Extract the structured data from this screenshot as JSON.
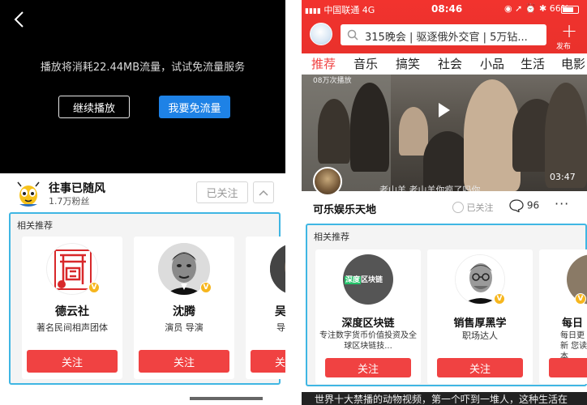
{
  "left": {
    "video": {
      "back_icon": "chevron-left-icon",
      "flow_notice": "播放将消耗22.44MB流量，试试免流量服务",
      "continue_label": "继续播放",
      "free_flow_label": "我要免流量"
    },
    "author": {
      "name": "往事已随风",
      "fans": "1.7万粉丝",
      "followed_label": "已关注",
      "collapse_icon": "chevron-up-icon"
    },
    "recommend": {
      "title": "相关推荐",
      "cards": [
        {
          "name": "德云社",
          "desc": "著名民间相声团体",
          "follow_label": "关注",
          "verified": "V"
        },
        {
          "name": "沈腾",
          "desc": "演员 导演",
          "follow_label": "关注",
          "verified": "V"
        },
        {
          "name": "吴",
          "desc": "导",
          "follow_label": "关",
          "verified": "V"
        }
      ]
    }
  },
  "right": {
    "status_bar": {
      "carrier": "中国联通 4G",
      "time": "08:46",
      "battery": "66%"
    },
    "header": {
      "search_text": "315晚会 | 驱逐俄外交官 | 5万钻...",
      "publish_label": "发布",
      "search_icon": "search-icon"
    },
    "channels": [
      "推荐",
      "音乐",
      "搞笑",
      "社会",
      "小品",
      "生活",
      "电影"
    ],
    "video": {
      "duration": "03:47",
      "subtitle": "老山羊 老山羊你疯了吗你",
      "top_caption": "08万次播放",
      "play_icon": "play-icon"
    },
    "author": {
      "name": "可乐娱乐天地",
      "followed_label": "已关注",
      "comment_count": "96",
      "more_label": "···"
    },
    "recommend": {
      "title": "相关推荐",
      "cards": [
        {
          "name": "深度区块链",
          "logo_left": "深度",
          "logo_right": "区块链",
          "desc": "专注数字货币价值投资及全球区块链技...",
          "follow_label": "关注"
        },
        {
          "name": "销售厚黑学",
          "desc": "职场达人",
          "follow_label": "关注",
          "verified": "V"
        },
        {
          "name": "每日",
          "desc": "每日更新 您读本",
          "follow_label": "",
          "verified": "V"
        }
      ]
    },
    "bottom_text": "世界十大禁播的动物视频，第一个吓到一堆人，这种生活在"
  },
  "colors": {
    "accent_red": "#f04242",
    "header_red": "#ed322d",
    "highlight_blue": "#3fb6e3",
    "button_blue": "#1e82e6",
    "verified_gold": "#f6b61e"
  }
}
